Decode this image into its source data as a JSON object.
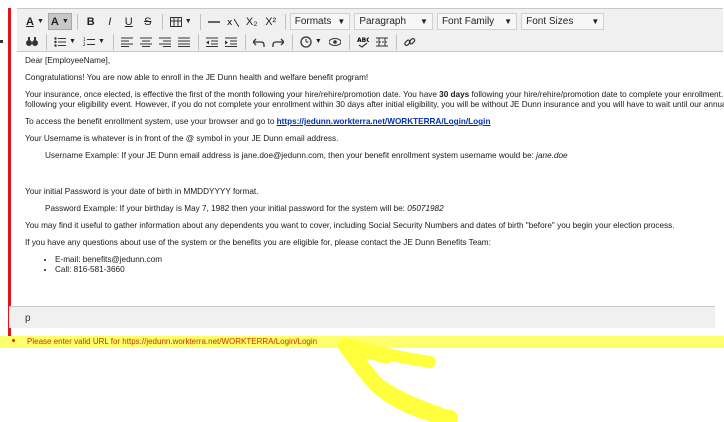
{
  "toolbar": {
    "formats": "Formats",
    "paragraph": "Paragraph",
    "font_family": "Font Family",
    "font_sizes": "Font Sizes",
    "font_color": "A",
    "bg_color": "A",
    "bold": "B",
    "italic": "I",
    "underline": "U",
    "strike": "S",
    "subscript": "X₂",
    "superscript": "X²"
  },
  "content": {
    "greeting": "Dear [EmployeeName],",
    "congrats": "Congratulations! You are now able to enroll in the JE Dunn health and welfare benefit program!",
    "ins_line1_a": "Your insurance, once elected, is effective the first of the month following your hire/rehire/promotion date. You have ",
    "ins_line1_bold": "30 days",
    "ins_line1_b": " following your hire/rehire/promotion date to complete your enrollment. ",
    "ins_line2": "following your eligibility event. However, if you do not complete your enrollment within 30 days after initial eligibility, you will be without JE Dunn insurance and you will have to wait until our annual",
    "access_a": "To access the benefit enrollment system, use your browser and go to ",
    "access_link": "https://jedunn.workterra.net/WORKTERRA/Login/Login",
    "username": "Your Username is whatever is in front of the @ symbol in your JE Dunn email address.",
    "username_ex_a": "Username Example: If your JE Dunn email address is jane.doe@jedunn.com, then your benefit enrollment system username would be: ",
    "username_ex_i": "jane.doe",
    "password": "Your initial Password is your date of birth in MMDDYYYY format.",
    "password_ex_a": "Password Example: If your birthday is May 7, 1982 then your initial password for the system will be: ",
    "password_ex_i": "05071982",
    "dependents": "You may find it useful to gather information about any dependents you want to cover, including Social Security Numbers and dates of birth \"before\" you begin your election process.",
    "questions": "If you have any questions about use of the system or the benefits you are eligible for, please contact the JE Dunn Benefits Team:",
    "email": "E-mail: benefits@jedunn.com",
    "call": "Call: 816-581-3660"
  },
  "status": {
    "path": "p"
  },
  "error": {
    "message": "Please enter valid URL for https://jedunn.workterra.net/WORKTERRA/Login/Login"
  },
  "colors": {
    "border_red": "#e8101a",
    "highlight": "#fdff6c",
    "error_text": "#d03000",
    "link": "#0033aa"
  }
}
